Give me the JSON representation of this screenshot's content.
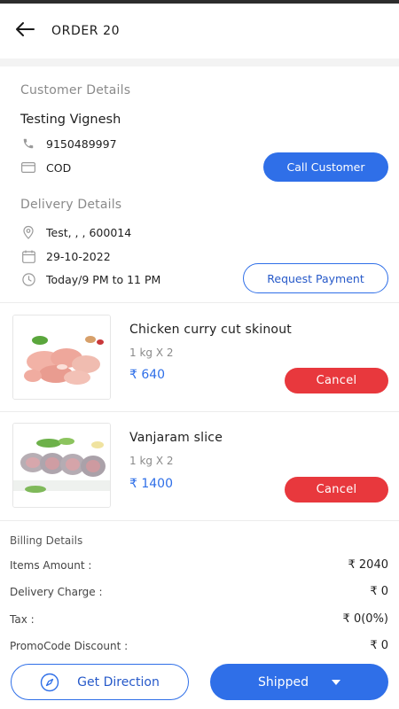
{
  "header": {
    "title": "ORDER 20",
    "back_icon": "arrow-left-icon"
  },
  "customer": {
    "section_title": "Customer Details",
    "name": "Testing Vignesh",
    "phone": "9150489997",
    "payment": "COD",
    "call_label": "Call Customer"
  },
  "delivery": {
    "section_title": "Delivery Details",
    "address": "Test, , , 600014",
    "date": "29-10-2022",
    "slot": "Today/9 PM to 11 PM",
    "request_label": "Request Payment"
  },
  "items": [
    {
      "name": "Chicken curry cut skinout",
      "qty": "1 kg X 2",
      "price": "₹ 640",
      "cancel_label": "Cancel",
      "image": "chicken-pieces-image"
    },
    {
      "name": "Vanjaram slice",
      "qty": "1 kg X 2",
      "price": "₹ 1400",
      "cancel_label": "Cancel",
      "image": "fish-slices-image"
    }
  ],
  "billing": {
    "title": "Billing Details",
    "rows": [
      {
        "label": "Items Amount :",
        "value": "₹ 2040"
      },
      {
        "label": "Delivery Charge :",
        "value": "₹ 0"
      },
      {
        "label": "Tax :",
        "value": "₹ 0(0%)"
      },
      {
        "label": "PromoCode Discount :",
        "value": "₹ 0"
      }
    ]
  },
  "actions": {
    "direction_label": "Get Direction",
    "status_label": "Shipped"
  },
  "colors": {
    "accent": "#2f6fe8",
    "danger": "#e8383d",
    "muted": "#8a8a8a"
  }
}
